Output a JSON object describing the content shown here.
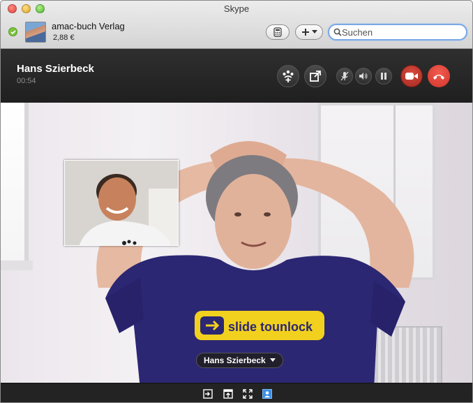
{
  "window": {
    "title": "Skype"
  },
  "profile": {
    "name": "amac-buch Verlag",
    "credit": "2,88 €",
    "status": "online"
  },
  "toolbar": {
    "search_placeholder": "Suchen"
  },
  "call": {
    "contact_name": "Hans Szierbeck",
    "duration": "00:54",
    "participant_label": "Hans Szierbeck"
  },
  "shirt": {
    "text": "slide tounlock"
  },
  "colors": {
    "hangup": "#e0453a",
    "accent": "#7aa7e6",
    "status_online": "#7cc33f"
  }
}
